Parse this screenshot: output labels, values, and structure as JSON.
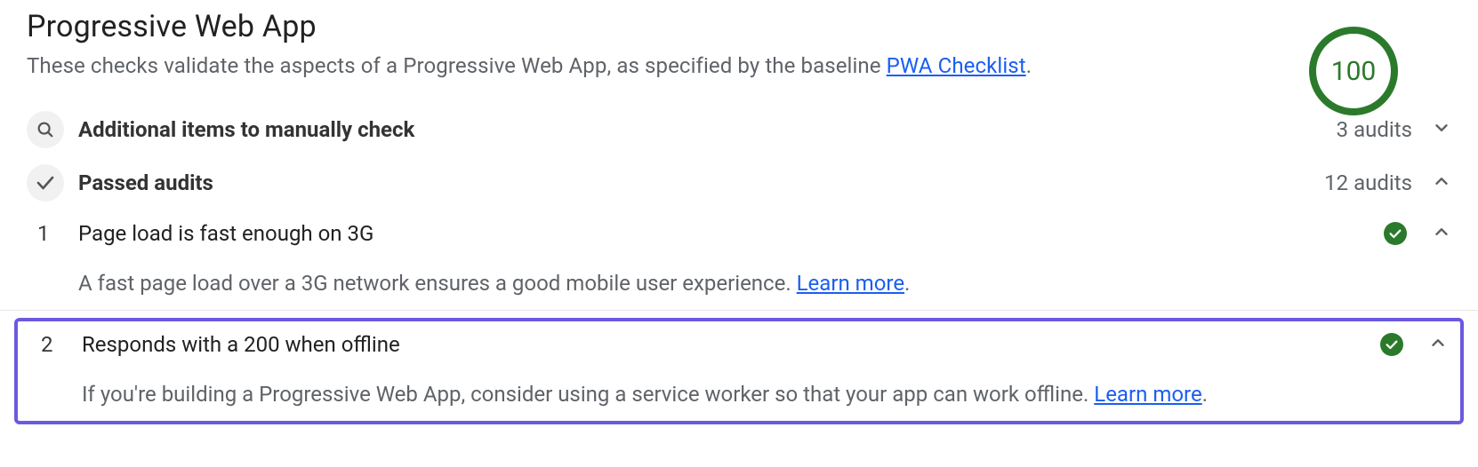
{
  "header": {
    "title": "Progressive Web App",
    "subtitle_before": "These checks validate the aspects of a Progressive Web App, as specified by the baseline ",
    "subtitle_link": "PWA Checklist",
    "subtitle_after": ".",
    "score": "100"
  },
  "groups": {
    "manual": {
      "label": "Additional items to manually check",
      "count": "3 audits"
    },
    "passed": {
      "label": "Passed audits",
      "count": "12 audits"
    }
  },
  "audits": [
    {
      "num": "1",
      "title": "Page load is fast enough on 3G",
      "desc_before": "A fast page load over a 3G network ensures a good mobile user experience. ",
      "learn_more": "Learn more",
      "desc_after": "."
    },
    {
      "num": "2",
      "title": "Responds with a 200 when offline",
      "desc_before": "If you're building a Progressive Web App, consider using a service worker so that your app can work offline. ",
      "learn_more": "Learn more",
      "desc_after": "."
    }
  ]
}
